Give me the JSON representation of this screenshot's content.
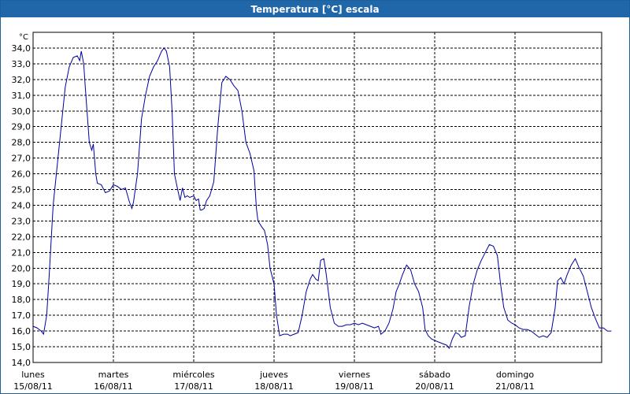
{
  "window": {
    "title": "Temperatura [°C] escala"
  },
  "colors": {
    "title_bar": "#1f67a8",
    "line": "#0000a0",
    "grid": "#000000",
    "text": "#000000"
  },
  "chart_data": {
    "type": "line",
    "title": "Temperatura [°C] escala",
    "ylabel": "°C",
    "xlabel": "",
    "ylim": [
      14,
      35
    ],
    "yticks": [
      "14,0",
      "15,0",
      "16,0",
      "17,0",
      "18,0",
      "19,0",
      "20,0",
      "21,0",
      "22,0",
      "23,0",
      "24,0",
      "25,0",
      "26,0",
      "27,0",
      "28,0",
      "29,0",
      "30,0",
      "31,0",
      "32,0",
      "33,0",
      "34,0"
    ],
    "xlim_days": [
      0,
      7
    ],
    "grid": true,
    "legend": "none",
    "day_ticks": [
      {
        "day": "lunes",
        "date": "15/08/11"
      },
      {
        "day": "martes",
        "date": "16/08/11"
      },
      {
        "day": "miércoles",
        "date": "17/08/11"
      },
      {
        "day": "jueves",
        "date": "18/08/11"
      },
      {
        "day": "viernes",
        "date": "19/08/11"
      },
      {
        "day": "sábado",
        "date": "20/08/11"
      },
      {
        "day": "domingo",
        "date": "21/08/11"
      }
    ],
    "series": [
      {
        "points": [
          [
            0.0,
            16.3
          ],
          [
            0.05,
            16.2
          ],
          [
            0.1,
            16.0
          ],
          [
            0.13,
            15.8
          ],
          [
            0.17,
            17.0
          ],
          [
            0.2,
            19.5
          ],
          [
            0.25,
            24.0
          ],
          [
            0.3,
            26.5
          ],
          [
            0.35,
            29.0
          ],
          [
            0.4,
            31.5
          ],
          [
            0.45,
            32.8
          ],
          [
            0.5,
            33.4
          ],
          [
            0.55,
            33.5
          ],
          [
            0.58,
            33.2
          ],
          [
            0.6,
            33.8
          ],
          [
            0.63,
            33.0
          ],
          [
            0.65,
            31.5
          ],
          [
            0.7,
            28.0
          ],
          [
            0.73,
            27.5
          ],
          [
            0.75,
            27.9
          ],
          [
            0.78,
            26.0
          ],
          [
            0.8,
            25.4
          ],
          [
            0.85,
            25.3
          ],
          [
            0.9,
            24.8
          ],
          [
            0.95,
            24.9
          ],
          [
            1.0,
            25.3
          ],
          [
            1.05,
            25.2
          ],
          [
            1.1,
            25.0
          ],
          [
            1.15,
            25.1
          ],
          [
            1.2,
            24.2
          ],
          [
            1.23,
            23.8
          ],
          [
            1.25,
            24.2
          ],
          [
            1.3,
            26.0
          ],
          [
            1.35,
            29.5
          ],
          [
            1.4,
            31.0
          ],
          [
            1.45,
            32.2
          ],
          [
            1.5,
            32.8
          ],
          [
            1.55,
            33.2
          ],
          [
            1.6,
            33.8
          ],
          [
            1.63,
            34.0
          ],
          [
            1.66,
            33.8
          ],
          [
            1.7,
            32.8
          ],
          [
            1.73,
            30.0
          ],
          [
            1.76,
            26.0
          ],
          [
            1.8,
            25.0
          ],
          [
            1.83,
            24.3
          ],
          [
            1.86,
            25.1
          ],
          [
            1.89,
            24.5
          ],
          [
            1.92,
            24.6
          ],
          [
            1.95,
            24.5
          ],
          [
            2.0,
            24.6
          ],
          [
            2.03,
            24.3
          ],
          [
            2.06,
            24.4
          ],
          [
            2.08,
            23.7
          ],
          [
            2.1,
            23.7
          ],
          [
            2.13,
            23.8
          ],
          [
            2.16,
            24.3
          ],
          [
            2.2,
            24.6
          ],
          [
            2.25,
            25.5
          ],
          [
            2.3,
            29.0
          ],
          [
            2.35,
            31.8
          ],
          [
            2.4,
            32.2
          ],
          [
            2.45,
            32.0
          ],
          [
            2.5,
            31.6
          ],
          [
            2.55,
            31.3
          ],
          [
            2.6,
            30.0
          ],
          [
            2.65,
            28.0
          ],
          [
            2.7,
            27.3
          ],
          [
            2.75,
            26.2
          ],
          [
            2.78,
            23.8
          ],
          [
            2.8,
            23.0
          ],
          [
            2.85,
            22.6
          ],
          [
            2.88,
            22.4
          ],
          [
            2.92,
            21.5
          ],
          [
            2.95,
            20.0
          ],
          [
            3.0,
            19.0
          ],
          [
            3.03,
            17.0
          ],
          [
            3.07,
            15.7
          ],
          [
            3.12,
            15.8
          ],
          [
            3.17,
            15.8
          ],
          [
            3.2,
            15.7
          ],
          [
            3.25,
            15.8
          ],
          [
            3.3,
            15.9
          ],
          [
            3.35,
            17.0
          ],
          [
            3.4,
            18.5
          ],
          [
            3.45,
            19.3
          ],
          [
            3.48,
            19.6
          ],
          [
            3.52,
            19.3
          ],
          [
            3.55,
            19.2
          ],
          [
            3.58,
            20.5
          ],
          [
            3.62,
            20.6
          ],
          [
            3.65,
            19.6
          ],
          [
            3.7,
            17.5
          ],
          [
            3.75,
            16.5
          ],
          [
            3.8,
            16.3
          ],
          [
            3.85,
            16.3
          ],
          [
            3.9,
            16.4
          ],
          [
            3.95,
            16.4
          ],
          [
            4.0,
            16.5
          ],
          [
            4.05,
            16.4
          ],
          [
            4.1,
            16.5
          ],
          [
            4.15,
            16.4
          ],
          [
            4.2,
            16.3
          ],
          [
            4.25,
            16.2
          ],
          [
            4.3,
            16.3
          ],
          [
            4.33,
            15.8
          ],
          [
            4.38,
            16.0
          ],
          [
            4.43,
            16.5
          ],
          [
            4.48,
            17.4
          ],
          [
            4.52,
            18.5
          ],
          [
            4.56,
            19.0
          ],
          [
            4.6,
            19.6
          ],
          [
            4.65,
            20.2
          ],
          [
            4.7,
            19.9
          ],
          [
            4.75,
            19.0
          ],
          [
            4.8,
            18.5
          ],
          [
            4.85,
            17.5
          ],
          [
            4.88,
            16.1
          ],
          [
            4.92,
            15.7
          ],
          [
            4.96,
            15.5
          ],
          [
            5.0,
            15.4
          ],
          [
            5.05,
            15.3
          ],
          [
            5.1,
            15.2
          ],
          [
            5.15,
            15.1
          ],
          [
            5.18,
            14.9
          ],
          [
            5.22,
            15.5
          ],
          [
            5.26,
            15.9
          ],
          [
            5.3,
            15.8
          ],
          [
            5.33,
            15.6
          ],
          [
            5.38,
            15.7
          ],
          [
            5.43,
            17.6
          ],
          [
            5.48,
            19.0
          ],
          [
            5.53,
            19.9
          ],
          [
            5.58,
            20.5
          ],
          [
            5.63,
            21.0
          ],
          [
            5.68,
            21.5
          ],
          [
            5.73,
            21.4
          ],
          [
            5.78,
            20.8
          ],
          [
            5.82,
            19.0
          ],
          [
            5.86,
            17.5
          ],
          [
            5.91,
            16.7
          ],
          [
            5.96,
            16.5
          ],
          [
            6.0,
            16.4
          ],
          [
            6.05,
            16.2
          ],
          [
            6.1,
            16.1
          ],
          [
            6.15,
            16.1
          ],
          [
            6.2,
            16.0
          ],
          [
            6.25,
            15.8
          ],
          [
            6.3,
            15.6
          ],
          [
            6.35,
            15.7
          ],
          [
            6.4,
            15.6
          ],
          [
            6.45,
            15.9
          ],
          [
            6.5,
            17.5
          ],
          [
            6.53,
            19.2
          ],
          [
            6.57,
            19.4
          ],
          [
            6.61,
            19.0
          ],
          [
            6.65,
            19.6
          ],
          [
            6.7,
            20.2
          ],
          [
            6.75,
            20.6
          ],
          [
            6.8,
            20.0
          ],
          [
            6.85,
            19.5
          ],
          [
            6.9,
            18.5
          ],
          [
            6.95,
            17.5
          ],
          [
            7.0,
            16.8
          ],
          [
            7.05,
            16.2
          ],
          [
            7.1,
            16.2
          ],
          [
            7.15,
            16.0
          ],
          [
            7.2,
            16.0
          ]
        ]
      }
    ]
  }
}
